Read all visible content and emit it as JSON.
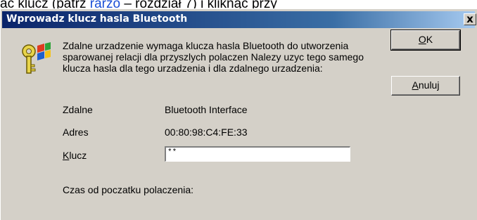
{
  "background_strip": {
    "before_link": "ac klucz (patrz ",
    "link": "rarzo",
    "after_link": " – rozdział 7) i kliknąć przy"
  },
  "dialog": {
    "title": "Wprowadz klucz hasla Bluetooth",
    "close_glyph": "x",
    "message": "Zdalne urzadzenie wymaga klucza hasla Bluetooth do utworzenia sparowanej relacji dla przyszlych polaczen Nalezy uzyc tego samego klucza hasla dla tego urzadzenia i dla zdalnego urzadzenia:",
    "remote_label": "Zdalne",
    "remote_value": "Bluetooth Interface",
    "address_label": "Adres",
    "address_value": "00:80:98:C4:FE:33",
    "key_label_mnemonic": "K",
    "key_label_rest": "lucz",
    "key_value": "**",
    "elapsed_label": "Czas od poczatku polaczenia:",
    "ok_mnemonic": "O",
    "ok_rest": "K",
    "cancel_mnemonic": "A",
    "cancel_rest": "nuluj"
  },
  "icons": {
    "key": "key-icon"
  }
}
